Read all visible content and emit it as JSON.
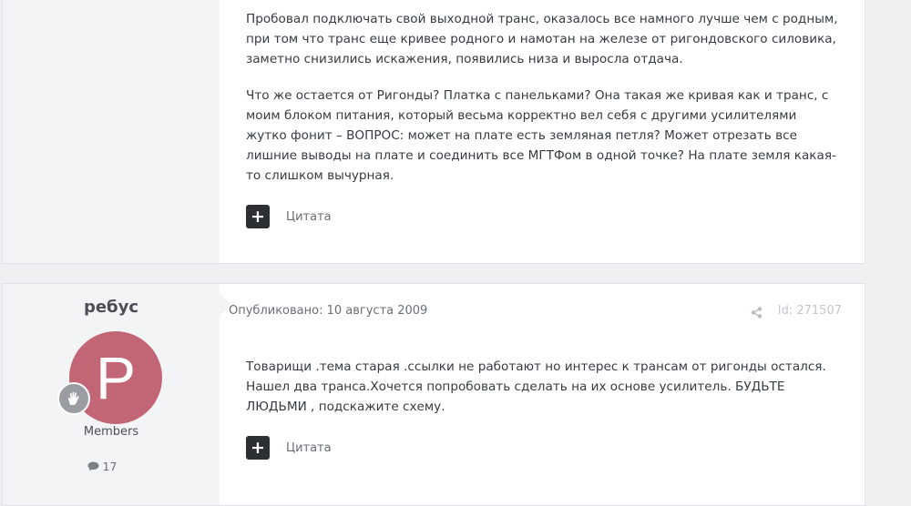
{
  "posts": [
    {
      "paragraphs": [
        "Пробовал подключать свой выходной транс, оказалось все намного лучше чем с родным, при том что транс еще кривее родного и намотан на железе от ригондовского силовика, заметно снизились искажения, появились низа и выросла отдача.",
        "Что же остается от Ригонды? Платка с панельками? Она такая же кривая как и транс, с моим блоком питания, который весьма корректно вел себя с другими усилителями жутко фонит – ВОПРОС: может на плате есть земляная петля? Может отрезать все лишние выводы на плате и соединить все МГТФом в одной точке? На плате земля какая- то слишком вычурная."
      ],
      "plus_label": "+",
      "quote_label": "Цитата"
    },
    {
      "author": {
        "name": "ребус",
        "avatar_letter": "P",
        "avatar_color": "#c26575",
        "badge_icon": "waving-hand-icon",
        "group": "Members",
        "post_count": "17"
      },
      "meta": {
        "published": "Опубликовано: 10 августа 2009",
        "id": "Id: 271507"
      },
      "paragraphs": [
        "Товарищи .тема старая .ссылки не работают но интерес к трансам от ригонды остался. Нашел два транса.Хочется попробовать сделать на их основе усилитель. БУДЬТЕ ЛЮДЬМИ , подскажите схему."
      ],
      "plus_label": "+",
      "quote_label": "Цитата"
    }
  ]
}
